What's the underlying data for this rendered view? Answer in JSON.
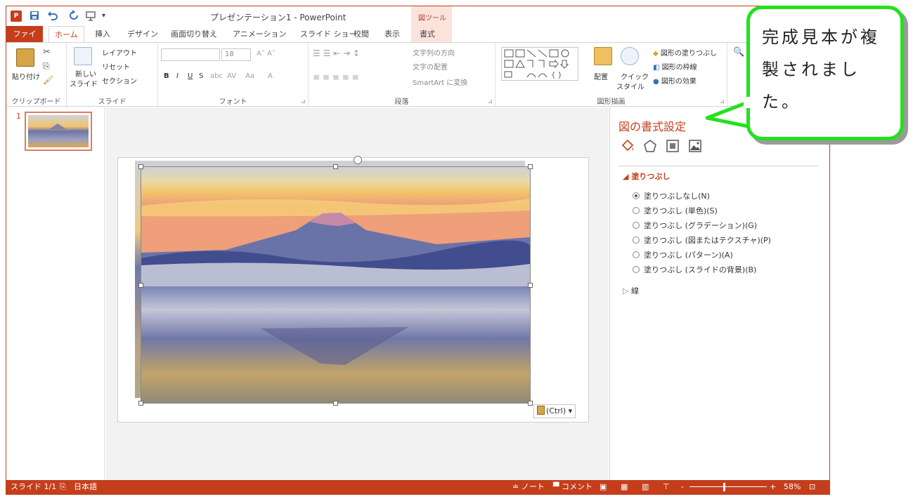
{
  "window": {
    "title": "プレゼンテーション1 - PowerPoint",
    "context_tool_group": "図ツール",
    "help": "?",
    "app_icon": "P"
  },
  "tabs": [
    "ファイル",
    "ホーム",
    "挿入",
    "デザイン",
    "画面切り替え",
    "アニメーション",
    "スライド ショー",
    "校閲",
    "表示",
    "書式"
  ],
  "active_tab": "ホーム",
  "ribbon": {
    "clipboard": {
      "label": "クリップボード",
      "paste": "貼り付け"
    },
    "slides": {
      "label": "スライド",
      "new_slide_1": "新しい",
      "new_slide_2": "スライド",
      "layout": "レイアウト",
      "reset": "リセット",
      "section": "セクション"
    },
    "font": {
      "label": "フォント",
      "size": "18"
    },
    "paragraph": {
      "label": "段落",
      "text_direction": "文字列の方向",
      "align_text": "文字の配置",
      "smartart": "SmartArt に変換"
    },
    "drawing": {
      "label": "図形描画",
      "arrange": "配置",
      "quick_styles_1": "クイック",
      "quick_styles_2": "スタイル",
      "shape_fill": "図形の塗りつぶし",
      "shape_outline": "図形の枠線",
      "shape_effects": "図形の効果"
    }
  },
  "thumbnails": {
    "number": "1"
  },
  "slide": {
    "paste_options": "(Ctrl)"
  },
  "format_pane": {
    "title": "図の書式設定",
    "fill_section": "塗りつぶし",
    "options": [
      "塗りつぶしなし(N)",
      "塗りつぶし (単色)(S)",
      "塗りつぶし (グラデーション)(G)",
      "塗りつぶし (図またはテクスチャ)(P)",
      "塗りつぶし (パターン)(A)",
      "塗りつぶし (スライドの背景)(B)"
    ],
    "selected_option_index": 0,
    "line_section": "線"
  },
  "status_bar": {
    "slide_count": "スライド 1/1",
    "language": "日本語",
    "notes": "ノート",
    "comments": "コメント",
    "zoom": "58%"
  },
  "callout": {
    "text": "完成見本が複製されました。"
  },
  "colors": {
    "accent": "#c43e1c",
    "callout_border": "#22e21c"
  }
}
